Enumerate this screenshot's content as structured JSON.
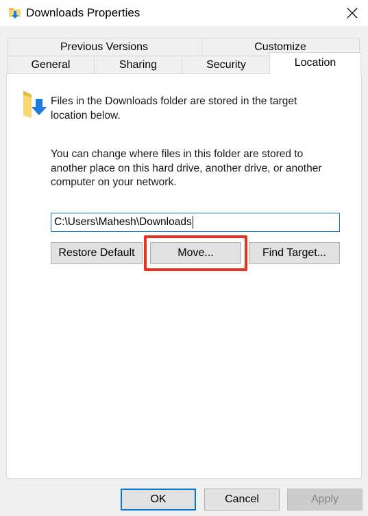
{
  "window": {
    "title": "Downloads Properties",
    "icons": {
      "title": "folder-download-icon",
      "close": "close-icon"
    }
  },
  "tabs": {
    "row1": [
      "Previous Versions",
      "Customize"
    ],
    "row2": [
      "General",
      "Sharing",
      "Security",
      "Location"
    ],
    "active": "Location"
  },
  "location": {
    "folder_icon": "downloads-folder-icon",
    "description": "Files in the Downloads folder are stored in the target location below.",
    "info": "You can change where files in this folder are stored to another place on this hard drive, another drive, or another computer on your network.",
    "path_value": "C:\\Users\\Mahesh\\Downloads",
    "buttons": {
      "restore_default": "Restore Default",
      "move": "Move...",
      "find_target": "Find Target..."
    }
  },
  "footer": {
    "ok": "OK",
    "cancel": "Cancel",
    "apply": "Apply"
  },
  "colors": {
    "highlight": "#e8321e",
    "focus": "#0078d7",
    "folder_yellow": "#f8d775",
    "arrow_blue": "#1e7be0"
  }
}
